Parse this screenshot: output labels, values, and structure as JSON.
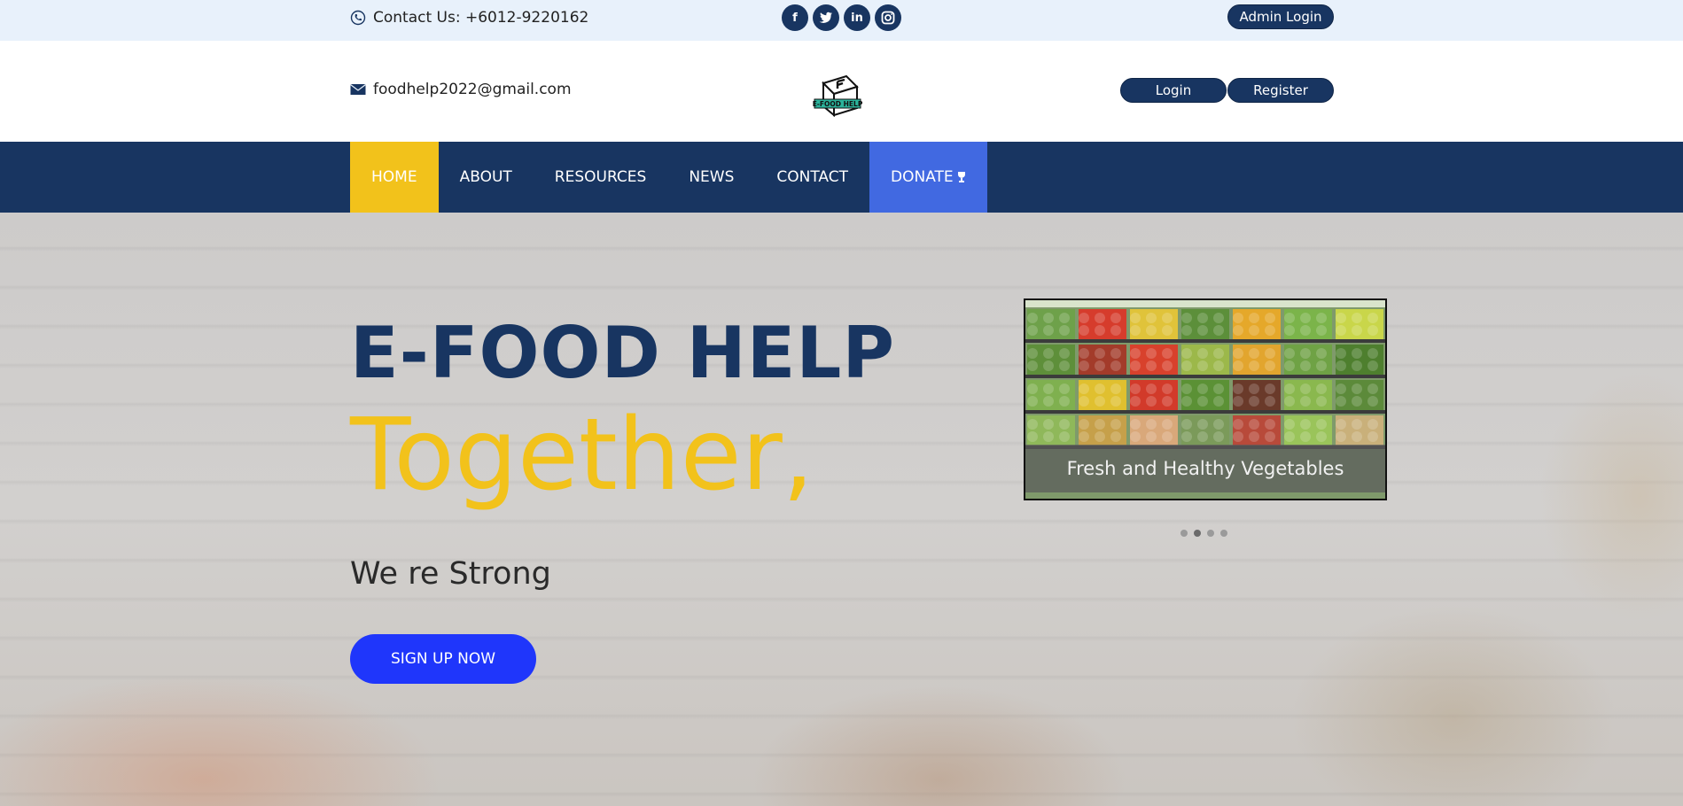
{
  "topbar": {
    "contact_text": "Contact Us: +6012-9220162",
    "contact_icon": "phone-icon",
    "socials": [
      {
        "name": "facebook-icon",
        "glyph": "f"
      },
      {
        "name": "twitter-icon",
        "glyph": "t"
      },
      {
        "name": "linkedin-icon",
        "glyph": "in"
      },
      {
        "name": "instagram-icon",
        "glyph": "◘"
      }
    ],
    "admin_login_label": "Admin Login"
  },
  "header": {
    "email_text": "foodhelp2022@gmail.com",
    "email_icon": "envelope-icon",
    "logo_text": "E-FOOD HELP",
    "login_label": "Login",
    "register_label": "Register"
  },
  "nav": {
    "items": [
      {
        "label": "HOME"
      },
      {
        "label": "ABOUT"
      },
      {
        "label": "RESOURCES"
      },
      {
        "label": "NEWS"
      },
      {
        "label": "CONTACT"
      },
      {
        "label": "DONATE"
      }
    ],
    "donate_icon": "trophy-icon"
  },
  "hero": {
    "title": "E-FOOD HELP",
    "together": "Together,",
    "subtitle": "We re Strong",
    "cta_label": "SIGN UP NOW",
    "carousel": {
      "caption": "Fresh and Healthy Vegetables",
      "slide_count": 4,
      "active_index": 1
    }
  },
  "colors": {
    "navy": "#183561",
    "yellow": "#f2c21b",
    "donate_blue": "#4169e1",
    "cta_blue": "#1f36fb",
    "topbar_bg": "#e8f1fb"
  }
}
